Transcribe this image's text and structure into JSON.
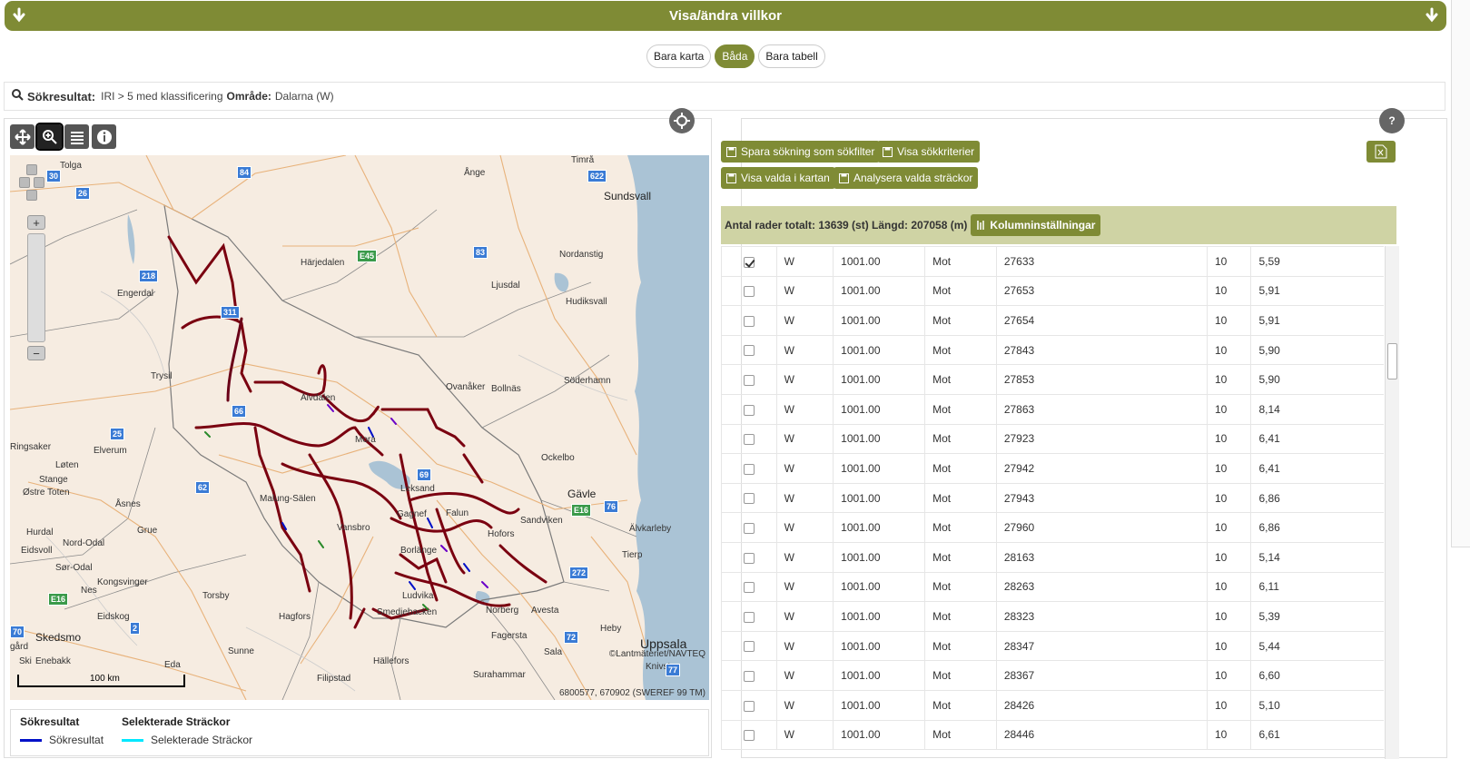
{
  "banner": {
    "title": "Visa/ändra villkor"
  },
  "view_toggle": {
    "map_only": "Bara karta",
    "both": "Båda",
    "table_only": "Bara tabell",
    "active": "both"
  },
  "search": {
    "label": "Sökresultat:",
    "query": "IRI > 5 med klassificering",
    "area_label": "Område:",
    "area_value": "Dalarna (W)"
  },
  "map": {
    "attribution": "©Lantmäteriet/NAVTEQ",
    "coordinates": "6800577, 670902 (SWEREF 99 TM)",
    "scale_label": "100 km",
    "places": {
      "tolga": "Tolga",
      "ange": "Ånge",
      "timra": "Timrå",
      "sundsvall": "Sundsvall",
      "harjedalen": "Härjedalen",
      "nordanstig": "Nordanstig",
      "ljusdal": "Ljusdal",
      "engerdal": "Engerdal",
      "hudiksvall": "Hudiksvall",
      "trysil": "Trysil",
      "ovanaker": "Ovanåker",
      "bollnas": "Bollnäs",
      "soderhamn": "Söderhamn",
      "alvdalen": "Älvdalen",
      "ringsaker": "Ringsaker",
      "loten": "Løten",
      "elverum": "Elverum",
      "mora": "Mora",
      "stange": "Stange",
      "ostre_toten": "Østre Toten",
      "ockelbo": "Ockelbo",
      "gavle": "Gävle",
      "asnes": "Åsnes",
      "malung": "Malung-Sälen",
      "leksand": "Leksand",
      "falun": "Falun",
      "gagnef": "Gagnef",
      "hurdal": "Hurdal",
      "nord_odal": "Nord-Odal",
      "grue": "Grue",
      "vansbro": "Vansbro",
      "hofors": "Hofors",
      "sandviken": "Sandviken",
      "alvkarleby": "Älvkarleby",
      "eidsvoll": "Eidsvoll",
      "sor_odal": "Sør-Odal",
      "borlange": "Borlänge",
      "tierp": "Tierp",
      "kongsvinger": "Kongsvinger",
      "nes": "Nes",
      "torsby": "Torsby",
      "ludvika": "Ludvika",
      "avesta": "Avesta",
      "smedjebacken": "Smedjebacken",
      "norberg": "Norberg",
      "eidskog": "Eidskog",
      "hagfors": "Hagfors",
      "heby": "Heby",
      "skedsmo": "Skedsmo",
      "fagersta": "Fagersta",
      "uppsala": "Uppsala",
      "sunne": "Sunne",
      "sala": "Sala",
      "enebakk": "Enebakk",
      "eda": "Eda",
      "hallefors": "Hällefors",
      "surahammar": "Surahammar",
      "knivsta": "Knivsta",
      "filipstad": "Filipstad",
      "gard": "gård",
      "ski": "Ski"
    },
    "roads": [
      "30",
      "26",
      "84",
      "622",
      "E45",
      "83",
      "218",
      "311",
      "66",
      "25",
      "62",
      "69",
      "E16",
      "76",
      "272",
      "E16",
      "2",
      "72",
      "70",
      "77"
    ]
  },
  "legend": {
    "col1_title": "Sökresultat",
    "col1_item": "Sökresultat",
    "col1_color": "#0010c8",
    "col2_title": "Selekterade Sträckor",
    "col2_item": "Selekterade Sträckor",
    "col2_color": "#00e8ff"
  },
  "table_panel": {
    "btn_save_filter": "Spara sökning som sökfilter",
    "btn_show_criteria": "Visa sökkriterier",
    "btn_show_selected": "Visa valda i kartan",
    "btn_analyse": "Analysera valda sträckor",
    "btn_columns": "Kolumninställningar",
    "summary": "Antal rader totalt: 13639 (st) Längd: 207058 (m)",
    "rows": [
      {
        "checked": true,
        "lan": "W",
        "vag": "1001.00",
        "dir": "Mot",
        "start": "27633",
        "len": "10",
        "iri": "5,59"
      },
      {
        "checked": false,
        "lan": "W",
        "vag": "1001.00",
        "dir": "Mot",
        "start": "27653",
        "len": "10",
        "iri": "5,91"
      },
      {
        "checked": false,
        "lan": "W",
        "vag": "1001.00",
        "dir": "Mot",
        "start": "27654",
        "len": "10",
        "iri": "5,91"
      },
      {
        "checked": false,
        "lan": "W",
        "vag": "1001.00",
        "dir": "Mot",
        "start": "27843",
        "len": "10",
        "iri": "5,90"
      },
      {
        "checked": false,
        "lan": "W",
        "vag": "1001.00",
        "dir": "Mot",
        "start": "27853",
        "len": "10",
        "iri": "5,90"
      },
      {
        "checked": false,
        "lan": "W",
        "vag": "1001.00",
        "dir": "Mot",
        "start": "27863",
        "len": "10",
        "iri": "8,14"
      },
      {
        "checked": false,
        "lan": "W",
        "vag": "1001.00",
        "dir": "Mot",
        "start": "27923",
        "len": "10",
        "iri": "6,41"
      },
      {
        "checked": false,
        "lan": "W",
        "vag": "1001.00",
        "dir": "Mot",
        "start": "27942",
        "len": "10",
        "iri": "6,41"
      },
      {
        "checked": false,
        "lan": "W",
        "vag": "1001.00",
        "dir": "Mot",
        "start": "27943",
        "len": "10",
        "iri": "6,86"
      },
      {
        "checked": false,
        "lan": "W",
        "vag": "1001.00",
        "dir": "Mot",
        "start": "27960",
        "len": "10",
        "iri": "6,86"
      },
      {
        "checked": false,
        "lan": "W",
        "vag": "1001.00",
        "dir": "Mot",
        "start": "28163",
        "len": "10",
        "iri": "5,14"
      },
      {
        "checked": false,
        "lan": "W",
        "vag": "1001.00",
        "dir": "Mot",
        "start": "28263",
        "len": "10",
        "iri": "6,11"
      },
      {
        "checked": false,
        "lan": "W",
        "vag": "1001.00",
        "dir": "Mot",
        "start": "28323",
        "len": "10",
        "iri": "5,39"
      },
      {
        "checked": false,
        "lan": "W",
        "vag": "1001.00",
        "dir": "Mot",
        "start": "28347",
        "len": "10",
        "iri": "5,44"
      },
      {
        "checked": false,
        "lan": "W",
        "vag": "1001.00",
        "dir": "Mot",
        "start": "28367",
        "len": "10",
        "iri": "6,60"
      },
      {
        "checked": false,
        "lan": "W",
        "vag": "1001.00",
        "dir": "Mot",
        "start": "28426",
        "len": "10",
        "iri": "5,10"
      },
      {
        "checked": false,
        "lan": "W",
        "vag": "1001.00",
        "dir": "Mot",
        "start": "28446",
        "len": "10",
        "iri": "6,61"
      }
    ]
  },
  "colors": {
    "accent": "#7f8b35",
    "summary_bar": "#cfd3a4",
    "water": "#aac3d5",
    "land": "#f6ece1"
  }
}
